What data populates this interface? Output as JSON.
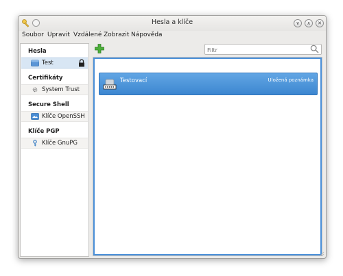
{
  "window": {
    "title": "Hesla a klíče"
  },
  "titlebar_buttons": {
    "minimize_icon": "chevron-down-icon",
    "maximize_icon": "chevron-up-icon",
    "close_icon": "close-icon"
  },
  "menu": {
    "items": [
      "Soubor",
      "Upravit",
      "Vzdálené",
      "Zobrazit",
      "Nápověda"
    ]
  },
  "toolbar": {
    "add_icon": "plus-icon",
    "filter_placeholder": "Filtr",
    "filter_value": ""
  },
  "sidebar": {
    "sections": [
      {
        "heading": "Hesla",
        "items": [
          {
            "label": "Test",
            "icon": "keyring-folder-icon",
            "selected": true,
            "locked": true
          }
        ]
      },
      {
        "heading": "Certifikáty",
        "items": [
          {
            "label": "System Trust",
            "icon": "gear-icon",
            "selected": false,
            "locked": false
          }
        ]
      },
      {
        "heading": "Secure Shell",
        "items": [
          {
            "label": "Klíče OpenSSH",
            "icon": "folder-icon",
            "selected": false,
            "locked": false
          }
        ]
      },
      {
        "heading": "Klíče PGP",
        "items": [
          {
            "label": "Klíče GnuPG",
            "icon": "key-icon",
            "selected": false,
            "locked": false
          }
        ]
      }
    ]
  },
  "content": {
    "items": [
      {
        "title": "Testovací",
        "type": "Uložená poznámka",
        "icon": "password-icon",
        "selected": true
      }
    ]
  },
  "colors": {
    "selection": "#3c86d0",
    "sidebar_selection": "#d8e6f4",
    "add_green": "#4caf3a"
  }
}
